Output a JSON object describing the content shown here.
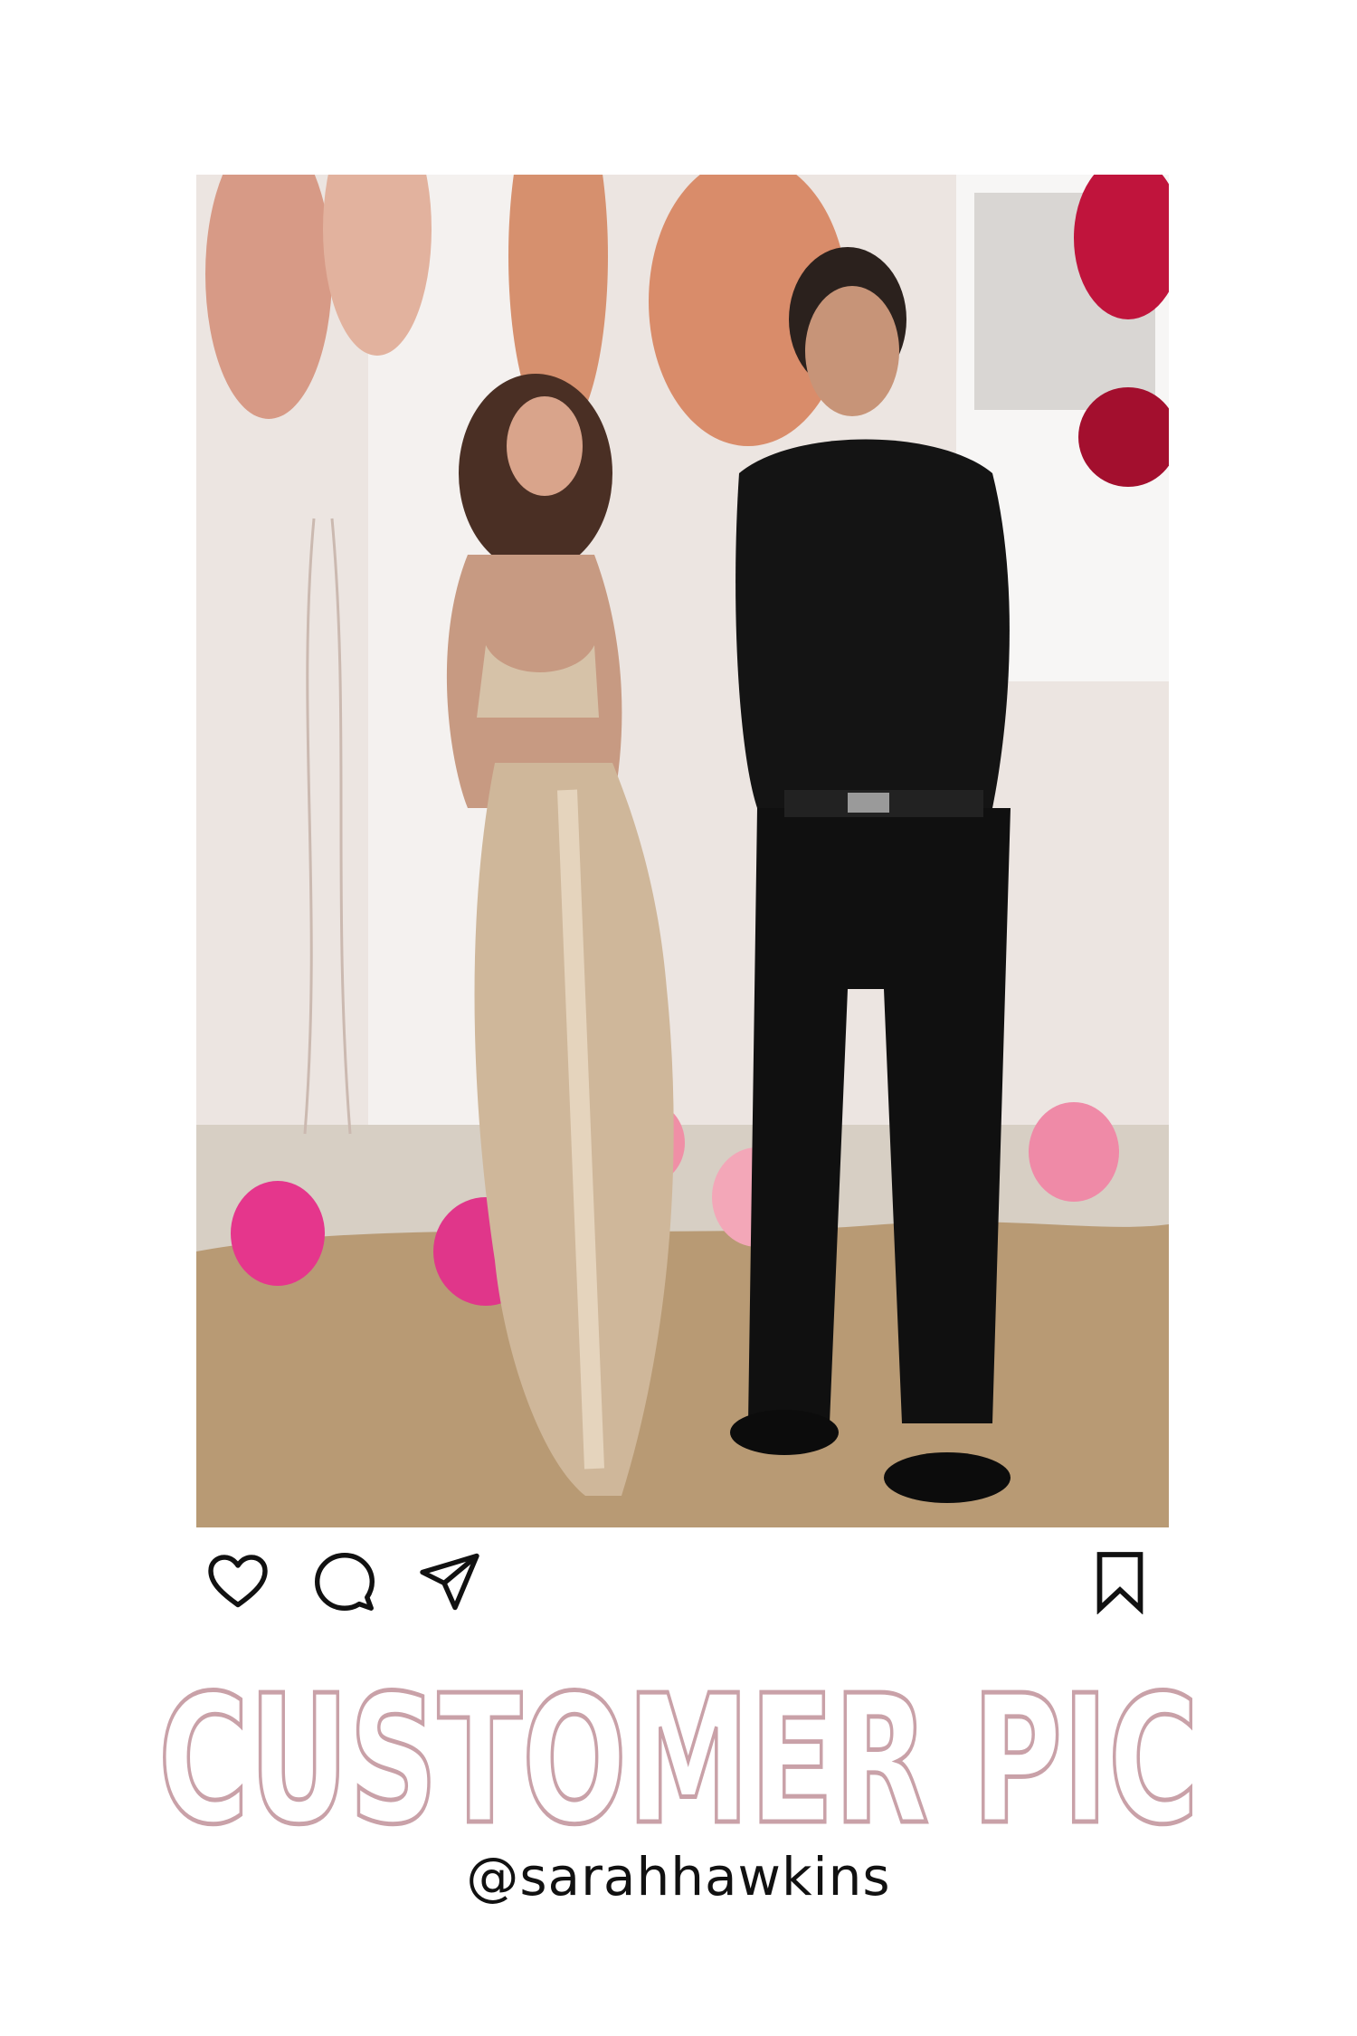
{
  "post": {
    "photo_label": "customer-photo",
    "actions": {
      "like_icon": "heart-icon",
      "comment_icon": "comment-bubble-icon",
      "share_icon": "paper-plane-icon",
      "save_icon": "bookmark-icon"
    }
  },
  "headline": {
    "text": "CUSTOMER PIC",
    "outline_color": "#c9a1a8"
  },
  "handle": {
    "text": "@sarahhawkins"
  }
}
